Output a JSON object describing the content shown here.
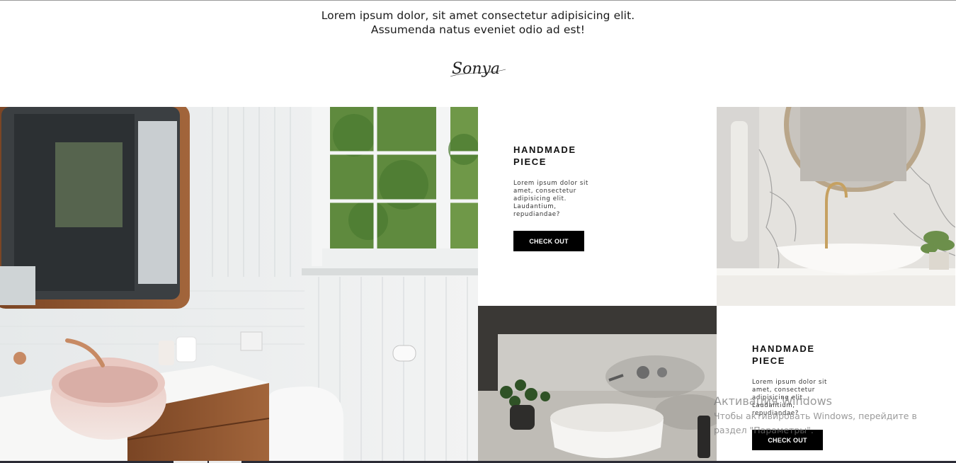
{
  "intro": {
    "line1": "Lorem ipsum dolor, sit amet consectetur adipisicing elit.",
    "line2": "Assumenda natus eveniet odio ad est!"
  },
  "signature": {
    "text": "Sonya"
  },
  "cards": [
    {
      "title_line1": "HANDMADE",
      "title_line2": "PIECE",
      "description": "Lorem ipsum dolor sit amet, consectetur adipisicing elit. Laudantium, repudiandae?",
      "button_label": "CHECK OUT"
    },
    {
      "title_line1": "HANDMADE",
      "title_line2": "PIECE",
      "description": "Lorem ipsum dolor sit amet, consectetur adipisicing elit. Laudantium, repudiandae?",
      "button_label": "CHECK OUT"
    }
  ],
  "watermark": {
    "title": "Активация Windows",
    "subtitle_line1": "Чтобы активировать Windows, перейдите в",
    "subtitle_line2": "раздел \"Параметры\"."
  },
  "images": {
    "left": "bathroom-pink-sink-photo",
    "marble": "marble-gold-mirror-photo",
    "dark": "concrete-wall-basin-photo"
  },
  "colors": {
    "button_bg": "#000000",
    "button_text": "#ffffff",
    "text": "#111111"
  }
}
